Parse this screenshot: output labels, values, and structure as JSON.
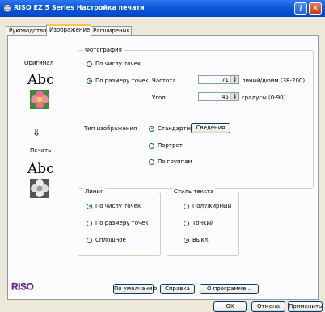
{
  "window": {
    "title": "RISO EZ 5 Series Настройка печати",
    "help_label": "?",
    "close_label": "✕"
  },
  "tabs": [
    "Руководство",
    "Изображение",
    "Расширения"
  ],
  "preview": {
    "original_label": "Оригинал",
    "print_label": "Печать",
    "sample_text": "Abc",
    "arrow": "⇩"
  },
  "photo": {
    "legend": "Фотография",
    "by_count": "По числу точек",
    "by_size": "По размеру точек",
    "frequency_label": "Частота",
    "frequency_value": "71",
    "frequency_unit": "линий/дюйм (38-200)",
    "angle_label": "Угол",
    "angle_value": "45",
    "angle_unit": "градусы (0-90)"
  },
  "image_type": {
    "label": "Тип изображения",
    "standard": "Стандартный",
    "info_button": "Сведения",
    "portrait": "Портрет",
    "by_groups": "По группам"
  },
  "line": {
    "legend": "Линия",
    "by_count": "По числу точек",
    "by_size": "По размеру точек",
    "solid": "Сплошное"
  },
  "text_style": {
    "legend": "Стиль текста",
    "semibold": "Полужирный",
    "thin": "Тонкий",
    "off": "Выкл."
  },
  "logo": "RISO",
  "panel_buttons": {
    "default": "По умолчанию",
    "help": "Справка",
    "about": "О программе..."
  },
  "dialog_buttons": {
    "ok": "OK",
    "cancel": "Отмена",
    "apply": "Применить"
  },
  "colors": {
    "title_blue": "#0A58D8",
    "logo_purple": "#6B2C91",
    "radio_green": "#21A121"
  }
}
